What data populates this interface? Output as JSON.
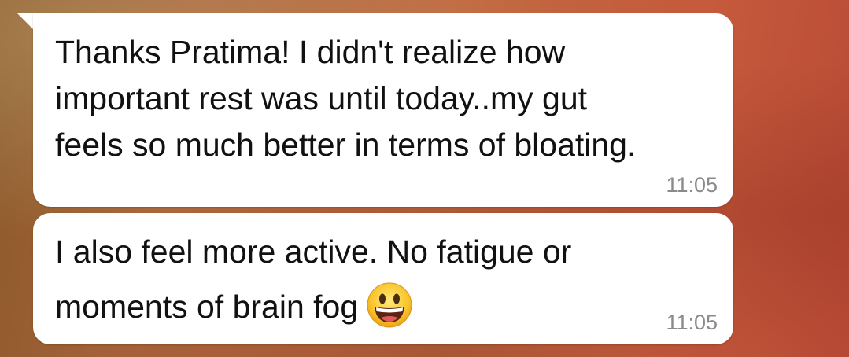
{
  "conversation": {
    "messages": [
      {
        "text_lines": [
          "Thanks Pratima! I didn't realize how",
          "important rest was until today..my gut",
          "feels so much better in terms of bloating."
        ],
        "time": "11:05"
      },
      {
        "text_lines": [
          "I also feel more active. No fatigue or",
          "moments of brain fog"
        ],
        "emoji": "grinning-face-emoji",
        "time": "11:05"
      }
    ]
  },
  "colors": {
    "bubble": "#ffffff",
    "text": "#111111",
    "timestamp": "#8a8a8a",
    "wallpaper": "#c0683f"
  }
}
